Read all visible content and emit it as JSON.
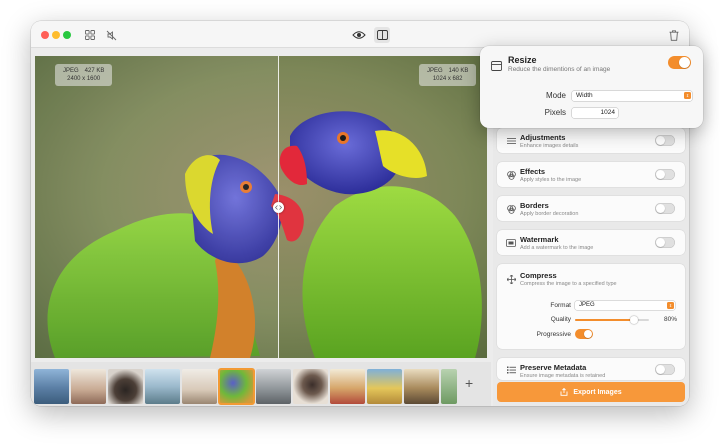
{
  "titlebar": {
    "icons": [
      "grid-icon",
      "mute-icon",
      "eye-icon",
      "split-view-icon",
      "trash-icon"
    ]
  },
  "canvas": {
    "left_badge": {
      "format": "JPEG",
      "size": "427 KB",
      "dimensions": "2400 x 1600"
    },
    "right_badge": {
      "format": "JPEG",
      "size": "140 KB",
      "dimensions": "1024 x 682"
    }
  },
  "filmstrip": {
    "selected_index": 5,
    "thumb_count": 11,
    "add_icon": "plus-icon"
  },
  "resize": {
    "title": "Resize",
    "subtitle": "Reduce the dimentions of an image",
    "enabled": true,
    "mode_label": "Mode",
    "mode_value": "Width",
    "pixels_label": "Pixels",
    "pixels_value": "1024"
  },
  "panels": {
    "adjustments": {
      "title": "Adjustments",
      "subtitle": "Enhance images details",
      "enabled": false
    },
    "effects": {
      "title": "Effects",
      "subtitle": "Apply styles to the image",
      "enabled": false
    },
    "borders": {
      "title": "Borders",
      "subtitle": "Apply border decoration",
      "enabled": false
    },
    "watermark": {
      "title": "Watermark",
      "subtitle": "Add a watermark to the image",
      "enabled": false
    },
    "compress": {
      "title": "Compress",
      "subtitle": "Compress the image to a specified type",
      "format_label": "Format",
      "format_value": "JPEG",
      "quality_label": "Quality",
      "quality_value": "80%",
      "quality_fraction": 0.8,
      "progressive_label": "Progressive",
      "progressive": true
    },
    "metadata": {
      "title": "Preserve Metadata",
      "subtitle": "Ensure image metadata is retained",
      "enabled": false
    }
  },
  "export_label": "Export Images",
  "colors": {
    "accent": "#f38d2c",
    "export": "#f7983a"
  }
}
